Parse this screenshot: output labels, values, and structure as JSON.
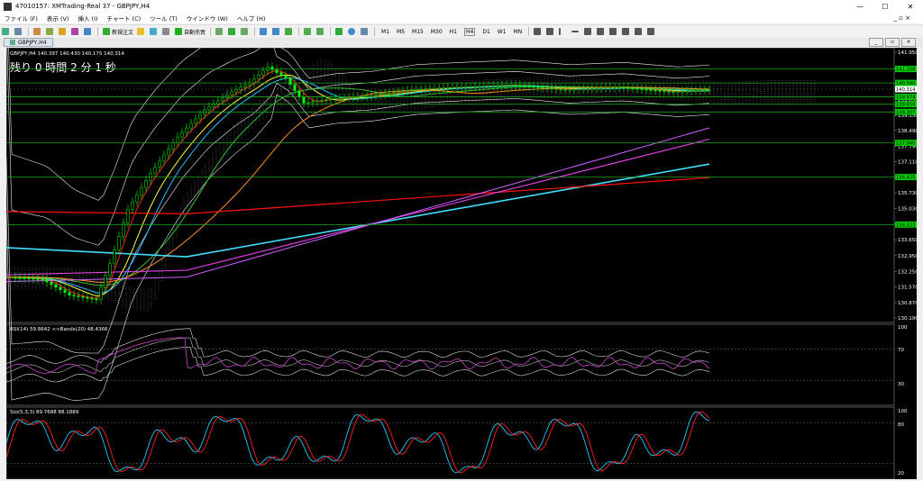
{
  "window": {
    "title": "47010157: XMTrading-Real 37 - GBPJPY,H4",
    "buttons": [
      "—",
      "☐",
      "✕"
    ]
  },
  "menu": {
    "items": [
      "ファイル (F)",
      "表示 (V)",
      "挿入 (I)",
      "チャート (C)",
      "ツール (T)",
      "ウインドウ (W)",
      "ヘルプ (H)"
    ],
    "right_controls": "_ ▫ ×"
  },
  "toolbar": {
    "new_order_label": "新規注文",
    "auto_trade_label": "自動売買",
    "timeframes": [
      "M1",
      "M5",
      "M15",
      "M30",
      "H1",
      "H4",
      "D1",
      "W1",
      "MN"
    ],
    "colors": {
      "active": "#2a7a2a"
    }
  },
  "tab": {
    "label": "GBPJPY,H4"
  },
  "chart": {
    "info_line": "GBPJPY,H4 140.397 140.430 140.175 140.314",
    "countdown": "残り 0 時間 2 分 1 秒",
    "price_ticks": [
      "141.950",
      "141.250",
      "140.550",
      "139.850",
      "139.150",
      "138.490",
      "137.790",
      "137.110",
      "136.410",
      "135.730",
      "135.030",
      "134.350",
      "133.650",
      "132.950",
      "132.250",
      "131.570",
      "130.870",
      "130.190"
    ],
    "badges": [
      {
        "label": "141.208",
        "color": "#00cc00"
      },
      {
        "label": "140.590",
        "color": "#00cc00"
      },
      {
        "label": "140.314",
        "color": "#ffffff"
      },
      {
        "label": "139.974",
        "color": "#00cc00"
      },
      {
        "label": "139.650",
        "color": "#00cc00"
      },
      {
        "label": "139.307",
        "color": "#00cc00"
      },
      {
        "label": "137.940",
        "color": "#00cc00"
      },
      {
        "label": "136.425",
        "color": "#00cc00"
      },
      {
        "label": "134.323",
        "color": "#00cc00"
      }
    ]
  },
  "rsi": {
    "label": "RSI(14) 59.8642  <<Bands(20) 48.4366",
    "ticks": [
      "100",
      "70",
      "30"
    ]
  },
  "stoch": {
    "label": "Sto(5,3,3) 89.7688 88.1889",
    "ticks": [
      "100",
      "80",
      "20"
    ]
  }
}
